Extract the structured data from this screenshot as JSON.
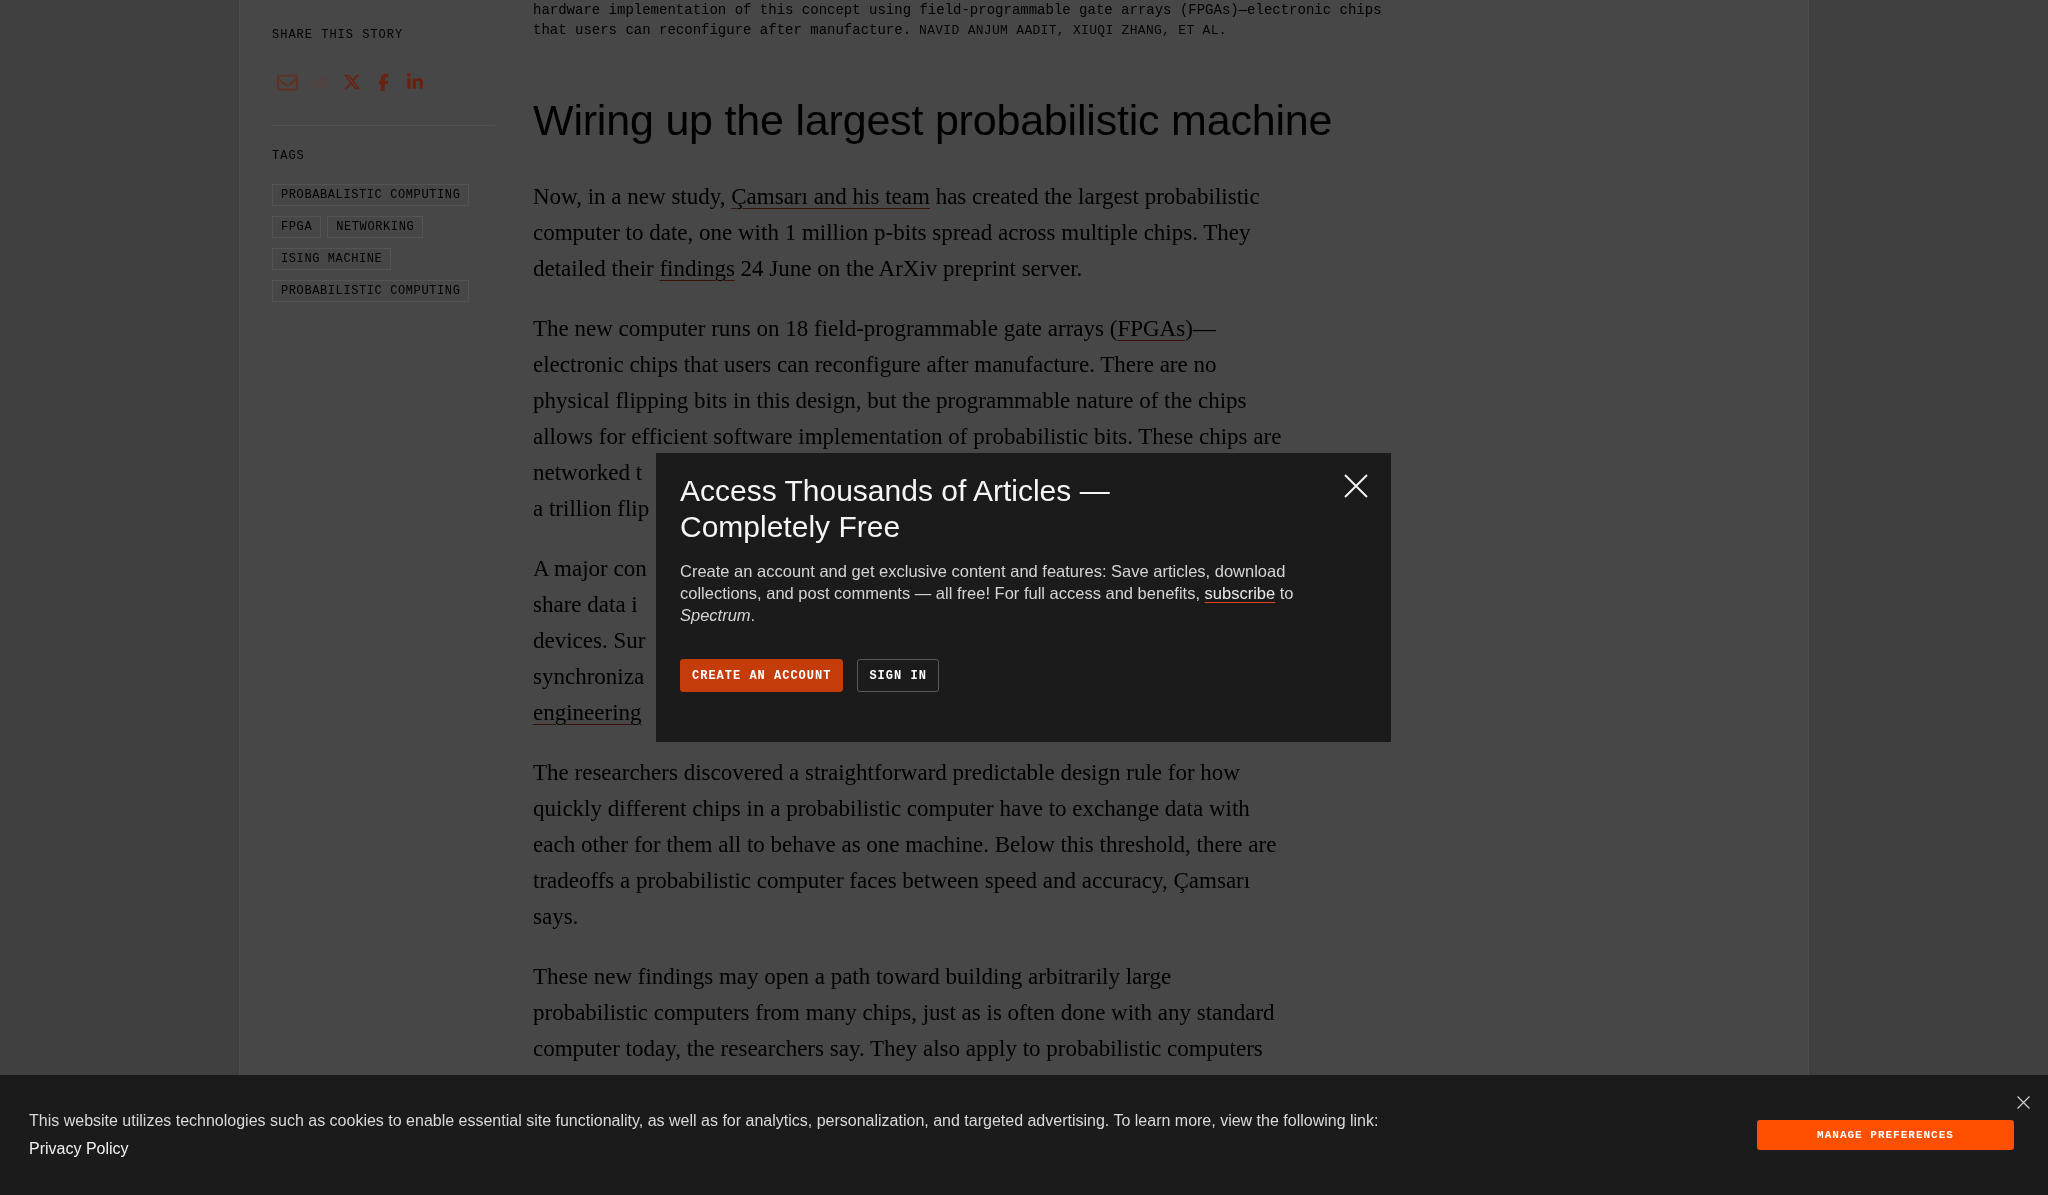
{
  "figure_caption": {
    "lines": [
      "hardware implementation of this concept using field-programmable gate arrays (FPGAs)—electronic chips",
      "that users can reconfigure after manufacture."
    ],
    "credit": "NAVID ANJUM AADIT, XIUQI ZHANG, ET AL."
  },
  "sidebar": {
    "share": {
      "heading": "SHARE THIS STORY",
      "links": [
        {
          "kind": "email"
        },
        {
          "kind": "copy-link"
        },
        {
          "kind": "x"
        },
        {
          "kind": "facebook"
        },
        {
          "kind": "linkedin"
        }
      ]
    },
    "tags": {
      "heading": "TAGS",
      "items": [
        "PROBABALISTIC COMPUTING",
        "FPGA",
        "NETWORKING",
        "ISING MACHINE",
        "PROBABILISTIC COMPUTING"
      ]
    }
  },
  "article": {
    "heading": "Wiring up the largest probabilistic machine",
    "paragraphs": [
      {
        "lines": [
          [
            {
              "kind": "text",
              "text": "Now, in a new study, "
            },
            {
              "kind": "link",
              "text": "Çamsarı and his team"
            },
            {
              "kind": "text",
              "text": " has created the largest probabilistic"
            }
          ],
          [
            {
              "kind": "text",
              "text": "computer to date, one with 1 million p-bits spread across multiple chips. They"
            }
          ],
          [
            {
              "kind": "text",
              "text": "detailed their "
            },
            {
              "kind": "link",
              "text": "findings"
            },
            {
              "kind": "text",
              "text": " 24 June on the ArXiv preprint server."
            }
          ]
        ]
      },
      {
        "lines": [
          [
            {
              "kind": "text",
              "text": "The new computer runs on 18 field-programmable gate arrays ("
            },
            {
              "kind": "link",
              "text": "FPGAs"
            },
            {
              "kind": "text",
              "text": ")—"
            }
          ],
          [
            {
              "kind": "text",
              "text": "electronic chips that users can reconfigure after manufacture. There are no"
            }
          ],
          [
            {
              "kind": "text",
              "text": "physical flipping bits in this design, but the programmable nature of the chips"
            }
          ],
          [
            {
              "kind": "text",
              "text": "allows for efficient software implementation of probabilistic bits. These chips are"
            }
          ]
        ],
        "cut_lines": [
          {
            "kind": "text",
            "text": "networked t"
          },
          {
            "kind": "text",
            "text": "a trillion flip"
          }
        ]
      },
      {
        "cut_lines": [
          {
            "kind": "text",
            "text": "A major con"
          },
          {
            "kind": "text",
            "text": "share data i"
          },
          {
            "kind": "text",
            "text": "devices. Sur"
          },
          {
            "kind": "text",
            "text": "synchroniza"
          },
          {
            "kind": "link",
            "text": "engineering"
          }
        ]
      },
      {
        "lines": [
          [
            {
              "kind": "text",
              "text": "The researchers discovered a straightforward predictable design rule for how"
            }
          ],
          [
            {
              "kind": "text",
              "text": "quickly different chips in a probabilistic computer have to exchange data with"
            }
          ],
          [
            {
              "kind": "text",
              "text": "each other for them all to behave as one machine. Below this threshold, there are"
            }
          ],
          [
            {
              "kind": "text",
              "text": "tradeoffs a probabilistic computer faces between speed and accuracy, Çamsarı"
            }
          ],
          [
            {
              "kind": "text",
              "text": "says."
            }
          ]
        ]
      },
      {
        "lines": [
          [
            {
              "kind": "text",
              "text": "These new findings may open a path toward building arbitrarily large"
            }
          ],
          [
            {
              "kind": "text",
              "text": "probabilistic computers from many chips, just as is often done with any standard"
            }
          ],
          [
            {
              "kind": "text",
              "text": "computer today, the researchers say. They also apply to probabilistic computers"
            }
          ]
        ]
      }
    ]
  },
  "signup_dialog": {
    "title": "Access Thousands of Articles — Completely Free",
    "body": [
      {
        "kind": "text",
        "text": "Create an account and get exclusive content and features: Save articles, download collections, and post comments — all free! For full access and benefits, "
      },
      {
        "kind": "link",
        "text": "subscribe"
      },
      {
        "kind": "text",
        "text": " to *Spectrum*."
      }
    ],
    "buttons": [
      {
        "label": "CREATE AN ACCOUNT",
        "kind": "primary"
      },
      {
        "label": "SIGN IN",
        "kind": "secondary"
      }
    ]
  },
  "cookie_banner": {
    "text": "This website utilizes technologies such as cookies to enable essential site functionality, as well as for analytics, personalization, and targeted advertising. To learn more, view the following link:",
    "link": "Privacy Policy",
    "button": "MANAGE PREFERENCES"
  }
}
